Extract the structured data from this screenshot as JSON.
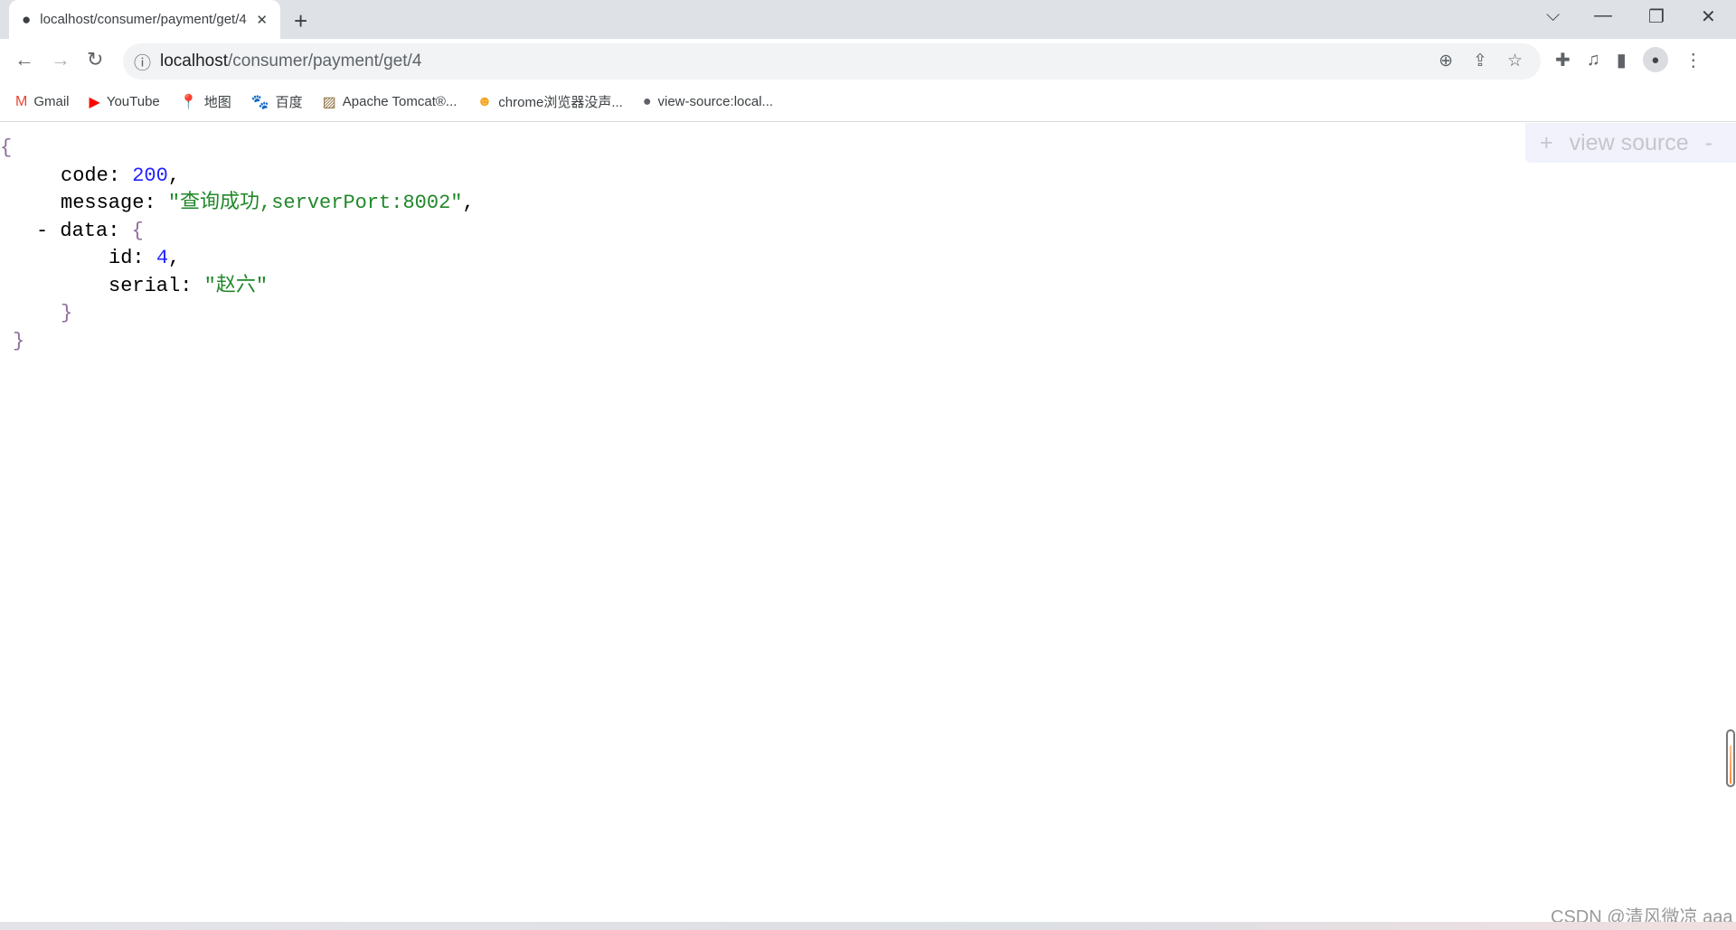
{
  "tab": {
    "title": "localhost/consumer/payment/get/4",
    "close": "✕",
    "new_tab": "+"
  },
  "window": {
    "tab_search": "⌵",
    "minimize": "—",
    "restore": "❐",
    "close": "✕"
  },
  "nav": {
    "back": "←",
    "forward": "→",
    "reload": "↻"
  },
  "address": {
    "host": "localhost",
    "path": "/consumer/payment/get/4",
    "info_icon": "ⓘ"
  },
  "omnibox_icons": [
    "zoom-icon",
    "share-icon",
    "star-icon"
  ],
  "toolbar_icons": [
    "extensions-icon",
    "media-icon",
    "side-panel-icon",
    "profile-icon",
    "menu-icon"
  ],
  "bookmarks": [
    {
      "label": "Gmail",
      "icon": "M",
      "color": "#ea4335"
    },
    {
      "label": "YouTube",
      "icon": "▶",
      "color": "#ff0000"
    },
    {
      "label": "地图",
      "icon": "📍",
      "color": "#34a853"
    },
    {
      "label": "百度",
      "icon": "🐾",
      "color": "#2932e1"
    },
    {
      "label": "Apache Tomcat®...",
      "icon": "▨",
      "color": "#8a6d3b"
    },
    {
      "label": "chrome浏览器没声...",
      "icon": "☻",
      "color": "#f5a623"
    },
    {
      "label": "view-source:local...",
      "icon": "●",
      "color": "#5f6368"
    }
  ],
  "json_view": {
    "open": "{",
    "close": "}",
    "code_key": "code",
    "code_val": "200",
    "message_key": "message",
    "message_val": "\"查询成功,serverPort:8002\"",
    "collapse": "-",
    "data_key": "data",
    "data_open": "{",
    "data_close": "}",
    "id_key": "id",
    "id_val": "4",
    "serial_key": "serial",
    "serial_val": "\"赵六\""
  },
  "view_source": {
    "plus": "+",
    "label": "view source",
    "minus": "-"
  },
  "watermark": "CSDN @清风微凉 aaa"
}
